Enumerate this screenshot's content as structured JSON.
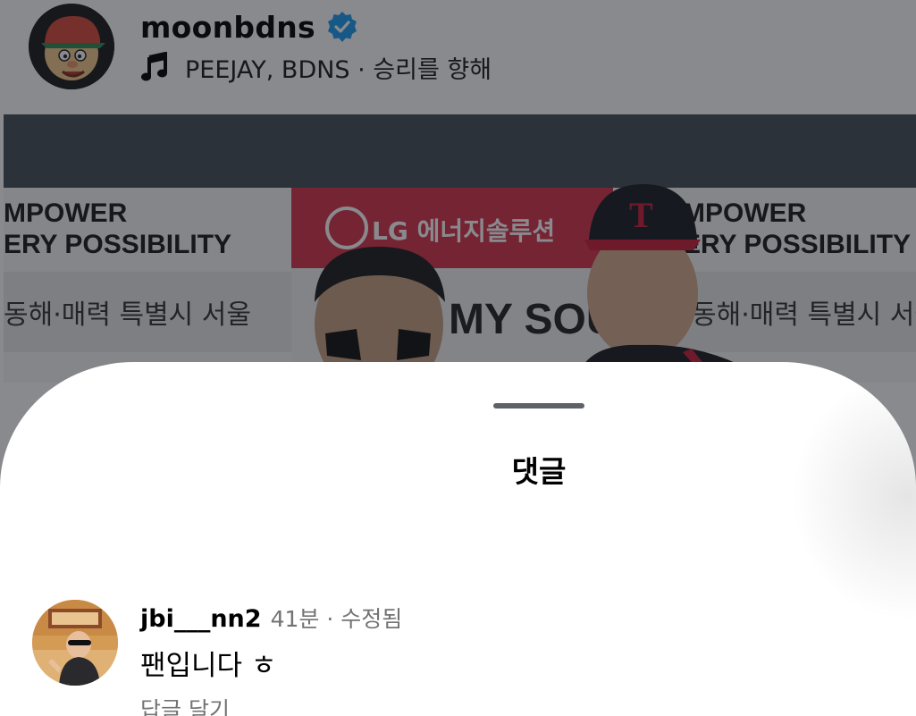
{
  "post": {
    "username": "moonbdns",
    "verified_icon": "verified-badge-icon",
    "music_icon": "music-note-icon",
    "music_text": "PEEJAY, BDNS · 승리를 향해",
    "photo": {
      "banner_left_line1": "MPOWER",
      "banner_left_line2": "ERY POSSIBILITY",
      "banner_left_line3": "동해·매력 특별시 서울",
      "banner_center_brand": "LG 에너지솔루션",
      "banner_center_sub": "MY SOUL",
      "banner_right_line1": "MPOWER",
      "banner_right_line2": "ERY POSSIBILITY",
      "banner_right_line3": "동해·매력 특별시 서울",
      "cap_letter": "T"
    }
  },
  "comments_sheet": {
    "title": "댓글",
    "comments": [
      {
        "username": "jbi___nn2",
        "meta": "41분 · 수정됨",
        "text": "팬입니다 ㅎ",
        "reply_label": "답글 달기"
      }
    ]
  },
  "colors": {
    "verified_blue": "#1d9bf0",
    "meta_gray": "#737373",
    "grabber": "#5e6166"
  }
}
